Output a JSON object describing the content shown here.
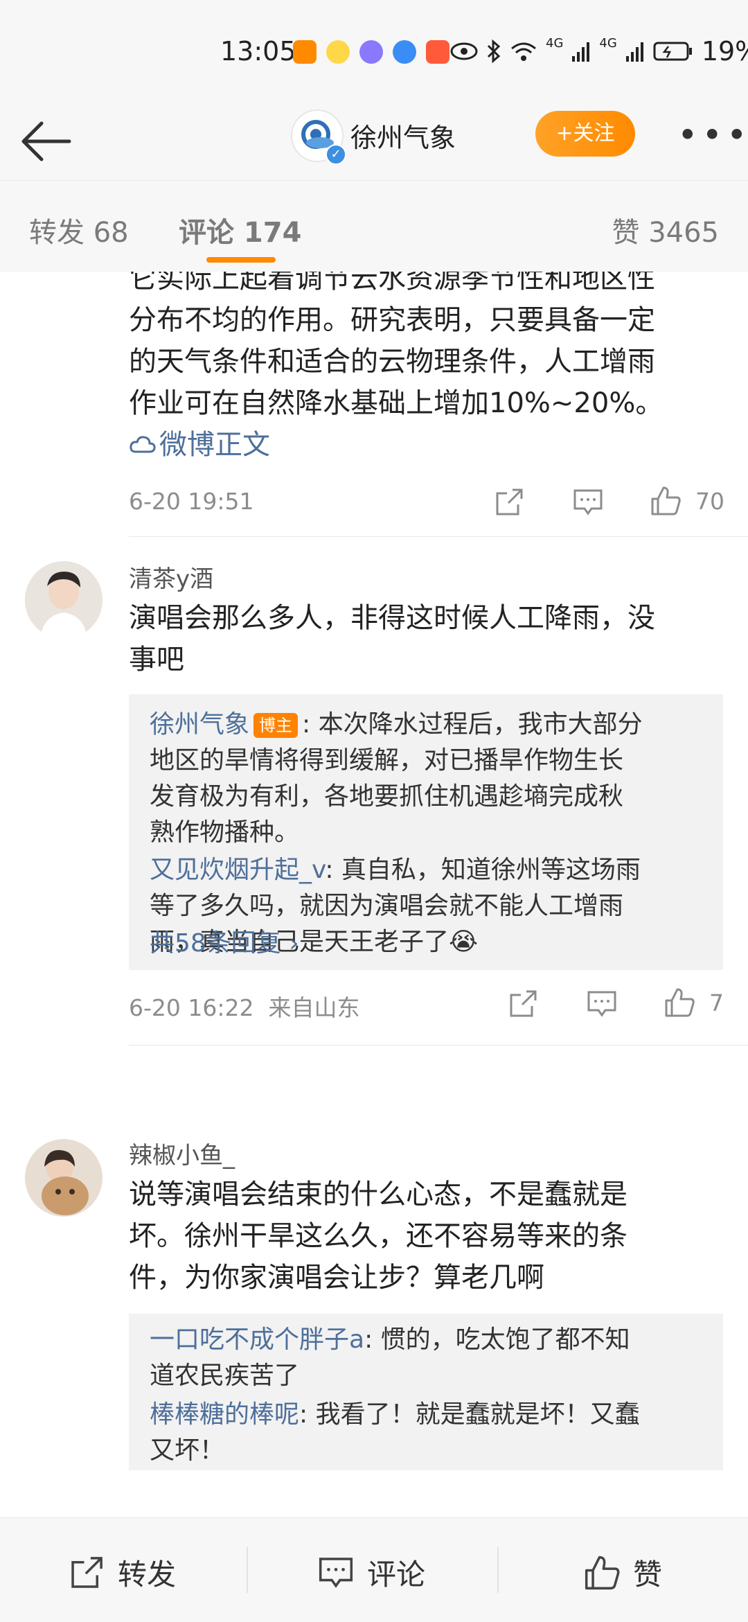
{
  "status_bar": {
    "time": "13:05",
    "battery": "19%",
    "signal_1": "4G",
    "signal_2": "4G"
  },
  "header": {
    "title": "徐州气象",
    "follow_label": "+关注",
    "more_label": "•••"
  },
  "tabs": {
    "repost": "转发 68",
    "comment": "评论 174",
    "like": "赞 3465"
  },
  "post": {
    "text_lines": [
      "它实际上起着调节云水资源季节性和地区性",
      "分布不均的作用。研究表明，只要具备一定",
      "的天气条件和适合的云物理条件，人工增雨",
      "作业可在自然降水基础上增加10%~20%。"
    ],
    "link_label": "微博正文",
    "timestamp": "6-20 19:51",
    "like_count": "70"
  },
  "comments": [
    {
      "username": "清茶y酒",
      "text_lines": [
        "演唱会那么多人，非得这时候人工降雨，没",
        "事吧"
      ],
      "replies": [
        {
          "name": "徐州气象",
          "badge": "博主",
          "text_lines": [
            ": 本次降水过程后，我市大部分",
            "地区的旱情将得到缓解，对已播旱作物生长",
            "发育极为有利，各地要抓住机遇趁墒完成秋",
            "熟作物播种。"
          ]
        },
        {
          "name": "又见炊烟升起_v",
          "text_lines": [
            ": 真自私，知道徐州等这场雨",
            "等了多久吗，就因为演唱会就不能人工增雨",
            "雨，真当自己是天王老子了😭"
          ]
        }
      ],
      "more_replies": "共58条回复 ›",
      "timestamp": "6-20 16:22  来自山东",
      "like_count": "7"
    },
    {
      "username": "辣椒小鱼_",
      "text_lines": [
        "说等演唱会结束的什么心态，不是蠢就是",
        "坏。徐州干旱这么久，还不容易等来的条",
        "件，为你家演唱会让步？算老几啊"
      ],
      "replies": [
        {
          "name": "一口吃不成个胖子a",
          "text_lines": [
            ": 惯的，吃太饱了都不知",
            "道农民疾苦了"
          ]
        },
        {
          "name": "棒棒糖的棒呢",
          "text_lines": [
            ": 我看了！就是蠢就是坏！又蠢",
            "又坏！"
          ]
        }
      ]
    }
  ],
  "bottom_bar": {
    "repost": "转发",
    "comment": "评论",
    "like": "赞"
  },
  "colors": {
    "accent": "#ff8a00",
    "link": "#4e6f9a",
    "badge": "#ff8200"
  }
}
